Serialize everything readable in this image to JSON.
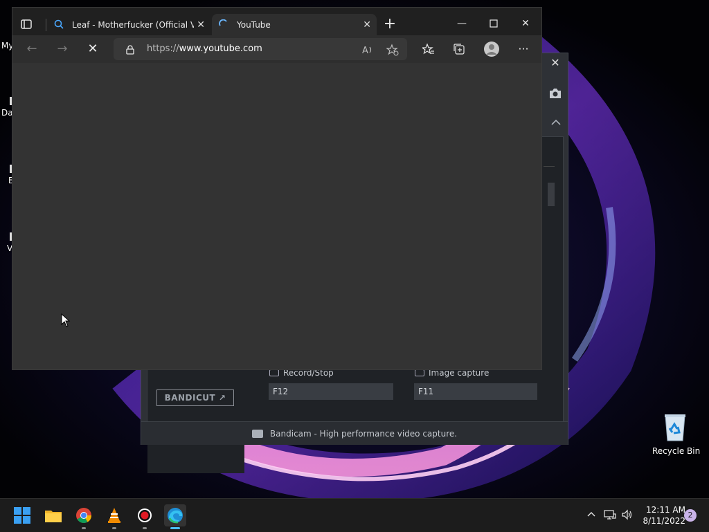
{
  "desktop": {
    "left_icons": [
      {
        "label": "My"
      },
      {
        "label": "Da"
      },
      {
        "label": "B"
      },
      {
        "label": "V"
      }
    ],
    "recycle_bin": {
      "label": "Recycle Bin"
    }
  },
  "bandicam": {
    "bandicut_label": "BANDICUT ↗",
    "hotkeys": [
      {
        "label": "Record/Stop",
        "value": "F12"
      },
      {
        "label": "Image capture",
        "value": "F11"
      }
    ],
    "status": "Bandicam - High performance video capture."
  },
  "browser": {
    "tabs": [
      {
        "title": "Leaf - Motherfucker (Official Vide",
        "active": false
      },
      {
        "title": "YouTube",
        "active": true
      }
    ],
    "url_prefix": "https://",
    "url_host": "www.youtube.com"
  },
  "taskbar": {
    "apps": [
      "start-icon",
      "file-explorer-icon",
      "chrome-icon",
      "vlc-icon",
      "bandicam-icon",
      "edge-icon"
    ],
    "time": "12:11 AM",
    "date": "8/11/2022",
    "notifications": "2"
  }
}
